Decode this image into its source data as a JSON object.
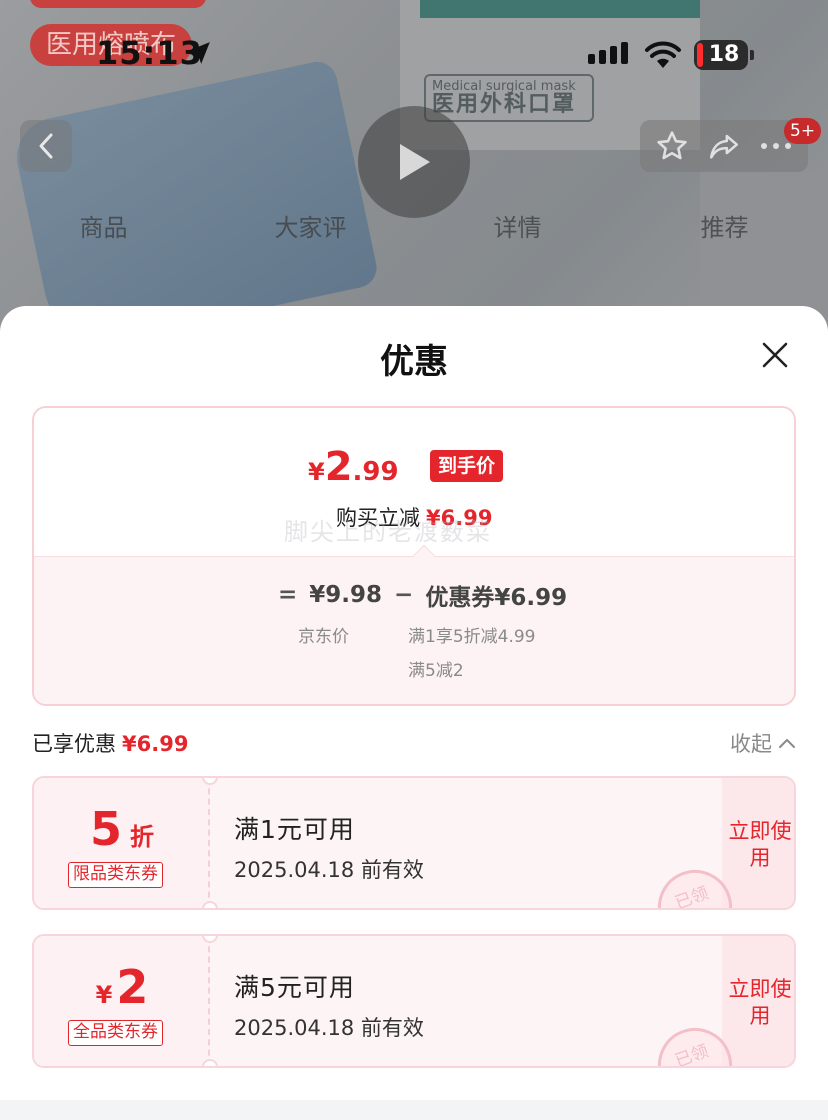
{
  "status_bar": {
    "time": "15:13",
    "battery": "18"
  },
  "background": {
    "promo_pill": "医用熔喷布",
    "box_label_en": "Medical surgical mask",
    "box_label_cn": "医用外科口罩",
    "notification_badge": "5+",
    "tabs": [
      "商品",
      "大家评",
      "详情",
      "推荐"
    ]
  },
  "sheet": {
    "title": "优惠",
    "price_card": {
      "final_price_symbol": "¥",
      "final_price_int": "2",
      "final_price_dec": ".99",
      "hand_price_tag": "到手价",
      "instant_cut_label": "购买立减",
      "instant_cut_amount": "¥6.99",
      "watermark": "脚尖上的老渡薮菜",
      "equals": "=",
      "jd_price": "¥9.98",
      "minus": "−",
      "coupon_label": "优惠券¥6.99",
      "jd_price_label": "京东价",
      "coupon_detail_1": "满1享5折减4.99",
      "coupon_detail_2": "满5减2"
    },
    "enjoyed": {
      "label": "已享优惠",
      "amount": "¥6.99",
      "collapse": "收起"
    },
    "coupons": [
      {
        "value": "5",
        "suffix": "折",
        "tag": "限品类东券",
        "condition": "满1元可用",
        "validity": "2025.04.18 前有效",
        "use": "立即使用",
        "stamp": "已领"
      },
      {
        "prefix": "¥",
        "value": "2",
        "tag": "全品类东券",
        "condition": "满5元可用",
        "validity": "2025.04.18 前有效",
        "use": "立即使用",
        "stamp": "已领"
      }
    ]
  },
  "colors": {
    "accent": "#e4262c",
    "card_border": "#f6d0d4",
    "card_tint": "#fdf3f5"
  }
}
